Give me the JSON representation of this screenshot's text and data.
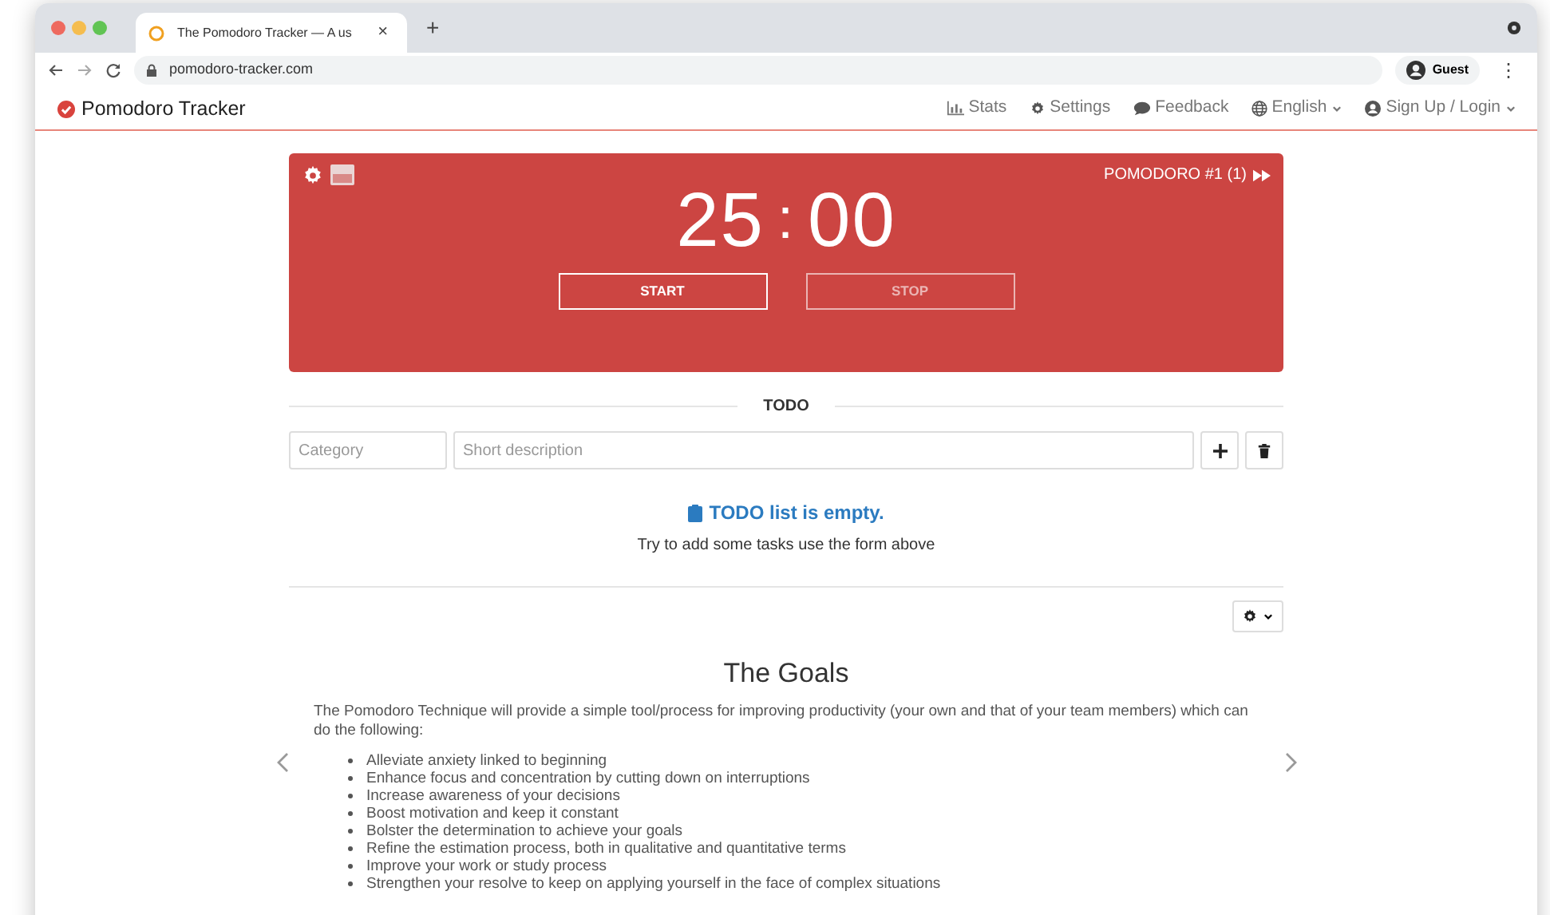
{
  "browser": {
    "tab": {
      "title": "The Pomodoro Tracker — A us",
      "close": "×"
    },
    "new_tab": "+",
    "url": "pomodoro-tracker.com",
    "profile": "Guest",
    "menu": "⋮"
  },
  "navbar": {
    "brand": "Pomodoro Tracker",
    "items": [
      {
        "label": "Stats",
        "kind": "chart",
        "dropdown": false
      },
      {
        "label": "Settings",
        "kind": "gear",
        "dropdown": false
      },
      {
        "label": "Feedback",
        "kind": "chat",
        "dropdown": false
      },
      {
        "label": "English",
        "kind": "globe",
        "dropdown": true
      },
      {
        "label": "Sign Up / Login",
        "kind": "user",
        "dropdown": true
      }
    ]
  },
  "timer": {
    "session": "POMODORO #1 (1)",
    "minutes": "25",
    "separator": ":",
    "seconds": "00",
    "buttons": [
      {
        "label": "START",
        "disabled": false
      },
      {
        "label": "STOP",
        "disabled": true
      }
    ]
  },
  "todo": {
    "heading": "TODO",
    "category": {
      "placeholder": "Category"
    },
    "description": {
      "placeholder": "Short description"
    },
    "empty_title": "TODO list is empty.",
    "empty_hint": "Try to add some tasks use the form above"
  },
  "goals": {
    "title": "The Goals",
    "intro": "The Pomodoro Technique will provide a simple tool/process for improving productivity (your own and that of your team members) which can do the following:",
    "items": [
      "Alleviate anxiety linked to beginning",
      "Enhance focus and concentration by cutting down on interruptions",
      "Increase awareness of your decisions",
      "Boost motivation and keep it constant",
      "Bolster the determination to achieve your goals",
      "Refine the estimation process, both in qualitative and quantitative terms",
      "Improve your work or study process",
      "Strengthen your resolve to keep on applying yourself in the face of complex situations"
    ]
  }
}
